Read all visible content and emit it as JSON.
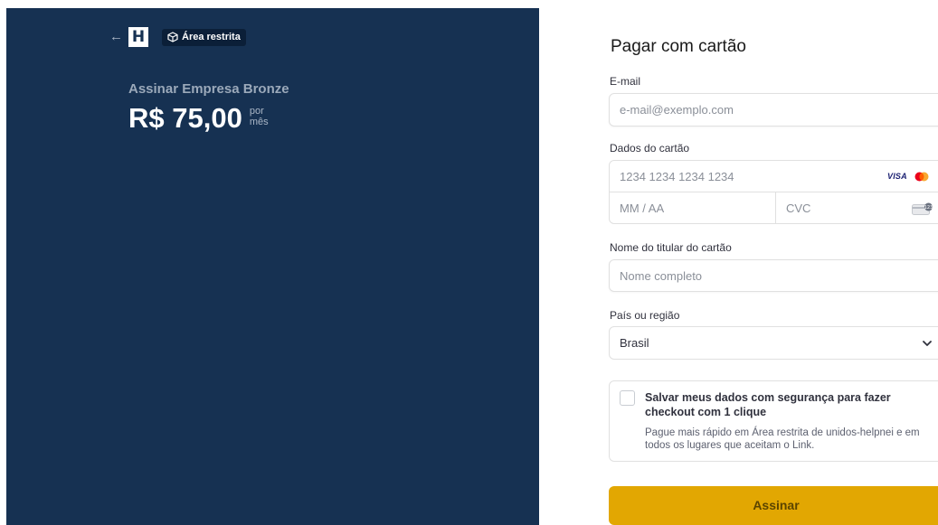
{
  "header": {
    "back_icon": "←",
    "logo_letter": "H",
    "badge_label": "Área restrita"
  },
  "summary": {
    "product": "Assinar Empresa Bronze",
    "price": "R$ 75,00",
    "per_line1": "por",
    "per_line2": "mês"
  },
  "form": {
    "title": "Pagar com cartão",
    "email_label": "E-mail",
    "email_placeholder": "e-mail@exemplo.com",
    "card_label": "Dados do cartão",
    "card_number_placeholder": "1234 1234 1234 1234",
    "card_brand_visa": "VISA",
    "expiry_placeholder": "MM / AA",
    "cvc_placeholder": "CVC",
    "name_label": "Nome do titular do cartão",
    "name_placeholder": "Nome completo",
    "country_label": "País ou região",
    "country_value": "Brasil",
    "save_title": "Salvar meus dados com segurança para fazer checkout com 1 clique",
    "save_description": "Pague mais rápido em Área restrita de unidos-helpnei e em todos os lugares que aceitam o Link.",
    "submit_label": "Assinar"
  },
  "colors": {
    "panel": "#163152",
    "accent": "#e2a702"
  }
}
